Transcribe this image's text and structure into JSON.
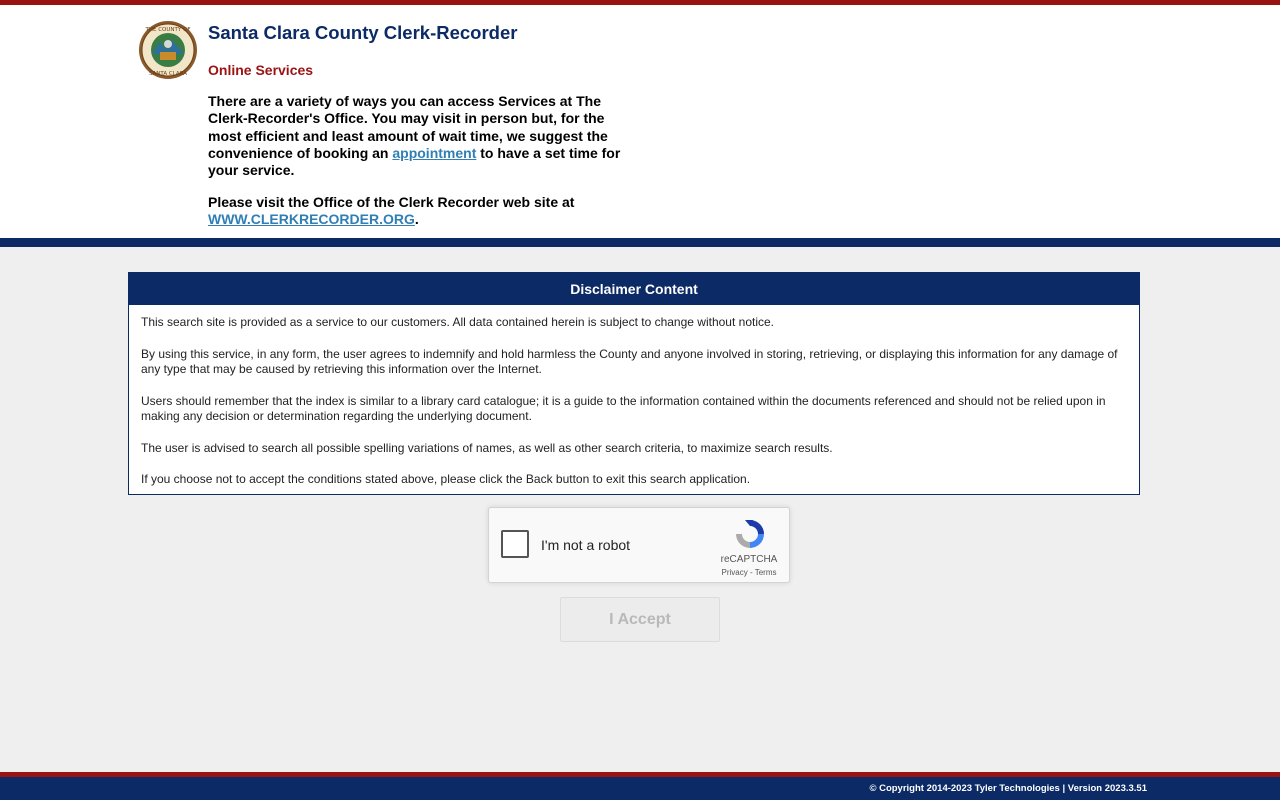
{
  "header": {
    "title": "Santa Clara County Clerk-Recorder",
    "subtitle": "Online Services",
    "intro_before_link": "There are a variety of ways you can access Services at The Clerk-Recorder's Office.  You may visit in person but, for the most efficient and least amount of wait time, we suggest the convenience of booking an ",
    "appointment_link": "appointment",
    "intro_after_link": " to have a set time for your service.",
    "visit_text": "Please visit the Office of the Clerk Recorder web site at",
    "site_link": "WWW.CLERKRECORDER.ORG",
    "site_link_suffix": ".",
    "seal_text_top": "THE COUNTY OF",
    "seal_text_bottom": "SANTA CLARA",
    "seal_icon": "county-seal"
  },
  "disclaimer": {
    "heading": "Disclaimer Content",
    "paragraphs": [
      "This search site is provided as a service to our customers. All data contained herein is subject to change without notice.",
      "By using this service, in any form, the user agrees to indemnify and hold harmless the County and anyone involved in storing, retrieving, or displaying this information for any damage of any type that may be caused by retrieving this information over the Internet.",
      "Users should remember that the index is similar to a library card catalogue; it is a guide to the information contained within the documents referenced and should not be relied upon in making any decision or determination regarding the underlying document.",
      "The user is advised to search all possible spelling variations of names, as well as other search criteria, to maximize search results.",
      "If you choose not to accept the conditions stated above, please click the Back button to exit this search application."
    ]
  },
  "captcha": {
    "label": "I'm not a robot",
    "brand": "reCAPTCHA",
    "privacy": "Privacy",
    "separator": " - ",
    "terms": "Terms",
    "icon": "recaptcha-icon"
  },
  "accept_button": "I Accept",
  "footer": {
    "text": "© Copyright 2014-2023 Tyler Technologies | Version 2023.3.51"
  },
  "colors": {
    "navy": "#0b2a66",
    "maroon": "#9b1212",
    "link": "#2f7fb5",
    "background": "#efefef"
  }
}
